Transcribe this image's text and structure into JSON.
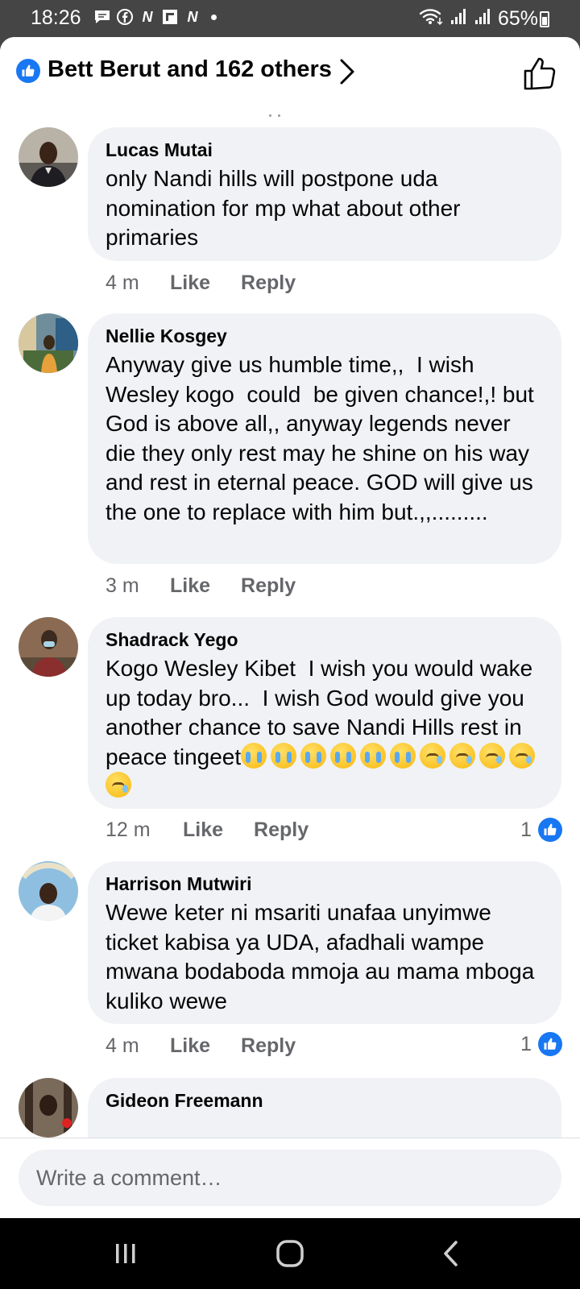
{
  "status_bar": {
    "time": "18:26",
    "battery": "65%",
    "left_icons": [
      "message-icon",
      "facebook-icon",
      "news-icon",
      "flipboard-icon",
      "news-icon"
    ],
    "right_icons": [
      "wifi-icon",
      "signal-icon",
      "signal-icon",
      "battery-icon"
    ]
  },
  "header": {
    "reactors": "Bett Berut and 162 others"
  },
  "comments": [
    {
      "author": "Lucas Mutai",
      "text": "only Nandi hills will postpone uda nomination for mp what about other primaries",
      "time": "4 m",
      "like": "Like",
      "reply": "Reply",
      "reactions": null
    },
    {
      "author": "Nellie Kosgey",
      "text": "Anyway give us humble time,,  I wish Wesley kogo  could  be given chance!,! but   God is above all,, anyway legends never die they only rest may he shine on his way and rest in eternal peace. GOD will give us the one to replace with him but.,,.........",
      "time": "3 m",
      "like": "Like",
      "reply": "Reply",
      "reactions": null
    },
    {
      "author": "Shadrack Yego",
      "text": "Kogo Wesley Kibet  I wish you would wake up today bro...  I wish God would give you another chance to save Nandi Hills rest in peace tingeet",
      "emojis": [
        "cry",
        "cry",
        "cry",
        "cry",
        "cry",
        "cry",
        "sleepy",
        "sleepy",
        "sleepy",
        "sleepy",
        "sleepy"
      ],
      "time": "12 m",
      "like": "Like",
      "reply": "Reply",
      "reactions": "1"
    },
    {
      "author": "Harrison Mutwiri",
      "text": "Wewe keter ni msariti unafaa unyimwe ticket kabisa ya UDA, afadhali wampe mwana bodaboda mmoja au mama mboga kuliko wewe",
      "time": "4 m",
      "like": "Like",
      "reply": "Reply",
      "reactions": "1"
    },
    {
      "author": "Gideon Freemann"
    }
  ],
  "composer": {
    "placeholder": "Write a comment…"
  },
  "colors": {
    "accent": "#1877f2",
    "bubble": "#f0f2f5",
    "secondary_text": "#65676b"
  }
}
